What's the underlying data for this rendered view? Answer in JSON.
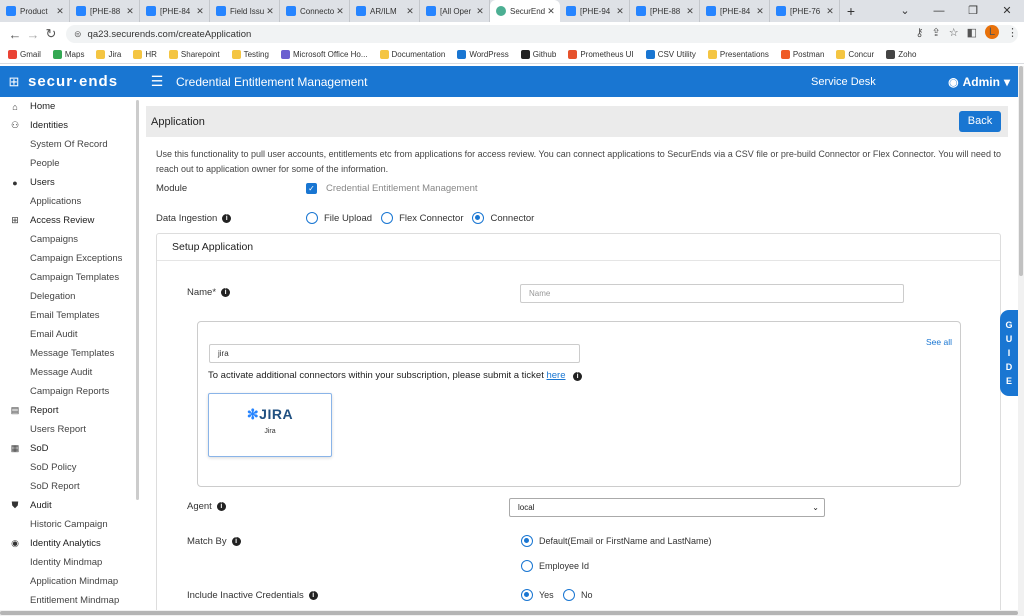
{
  "browser": {
    "tabs": [
      {
        "title": "Product",
        "icon": "puzzle-icon",
        "active": false
      },
      {
        "title": "[PHE-88",
        "icon": "jira-icon",
        "active": false
      },
      {
        "title": "[PHE-84",
        "icon": "jira-icon",
        "active": false
      },
      {
        "title": "Field Issu",
        "icon": "jira-icon",
        "active": false
      },
      {
        "title": "Connecto",
        "icon": "jira-icon",
        "active": false
      },
      {
        "title": "AR/ILM",
        "icon": "jira-icon",
        "active": false
      },
      {
        "title": "[All Oper",
        "icon": "jira-icon",
        "active": false
      },
      {
        "title": "SecurEnd",
        "icon": "globe-icon",
        "active": true
      },
      {
        "title": "[PHE-94",
        "icon": "jira-icon",
        "active": false
      },
      {
        "title": "[PHE-88",
        "icon": "jira-icon",
        "active": false
      },
      {
        "title": "[PHE-84",
        "icon": "jira-icon",
        "active": false
      },
      {
        "title": "[PHE-76",
        "icon": "jira-icon",
        "active": false
      }
    ],
    "new_tab": "+",
    "url": "qa23.securends.com/createApplication",
    "profile_initial": "L",
    "bookmarks": [
      {
        "label": "Gmail",
        "color": "#ea4335"
      },
      {
        "label": "Maps",
        "color": "#34a853"
      },
      {
        "label": "Jira",
        "color": "#f4c542"
      },
      {
        "label": "HR",
        "color": "#f4c542"
      },
      {
        "label": "Sharepoint",
        "color": "#f4c542"
      },
      {
        "label": "Testing",
        "color": "#f4c542"
      },
      {
        "label": "Microsoft Office Ho...",
        "color": "#6b5fd0"
      },
      {
        "label": "Documentation",
        "color": "#f4c542"
      },
      {
        "label": "WordPress",
        "color": "#1976d2"
      },
      {
        "label": "Github",
        "color": "#222222"
      },
      {
        "label": "Prometheus UI",
        "color": "#e6522c"
      },
      {
        "label": "CSV Utility",
        "color": "#1976d2"
      },
      {
        "label": "Presentations",
        "color": "#f4c542"
      },
      {
        "label": "Postman",
        "color": "#ef5b25"
      },
      {
        "label": "Concur",
        "color": "#f4c542"
      },
      {
        "label": "Zoho",
        "color": "#444444"
      }
    ]
  },
  "header": {
    "brand": "secur·ends",
    "title": "Credential Entitlement Management",
    "service_desk": "Service Desk",
    "admin": "Admin"
  },
  "sidebar": {
    "items": [
      {
        "label": "Home",
        "section": true,
        "icon": "home-icon"
      },
      {
        "label": "Identities",
        "section": true,
        "icon": "people-icon"
      },
      {
        "label": "System Of Record",
        "section": false
      },
      {
        "label": "People",
        "section": false
      },
      {
        "label": "Users",
        "section": true,
        "icon": "user-icon"
      },
      {
        "label": "Applications",
        "section": false
      },
      {
        "label": "Access Review",
        "section": true,
        "icon": "grid-icon"
      },
      {
        "label": "Campaigns",
        "section": false
      },
      {
        "label": "Campaign Exceptions",
        "section": false
      },
      {
        "label": "Campaign Templates",
        "section": false
      },
      {
        "label": "Delegation",
        "section": false
      },
      {
        "label": "Email Templates",
        "section": false
      },
      {
        "label": "Email Audit",
        "section": false
      },
      {
        "label": "Message Templates",
        "section": false
      },
      {
        "label": "Message Audit",
        "section": false
      },
      {
        "label": "Campaign Reports",
        "section": false
      },
      {
        "label": "Report",
        "section": true,
        "icon": "report-icon"
      },
      {
        "label": "Users Report",
        "section": false
      },
      {
        "label": "SoD",
        "section": true,
        "icon": "table-icon"
      },
      {
        "label": "SoD Policy",
        "section": false
      },
      {
        "label": "SoD Report",
        "section": false
      },
      {
        "label": "Audit",
        "section": true,
        "icon": "shield-icon"
      },
      {
        "label": "Historic Campaign",
        "section": false
      },
      {
        "label": "Identity Analytics",
        "section": true,
        "icon": "circle-icon"
      },
      {
        "label": "Identity Mindmap",
        "section": false
      },
      {
        "label": "Application Mindmap",
        "section": false
      },
      {
        "label": "Entitlement Mindmap",
        "section": false
      }
    ]
  },
  "page": {
    "title": "Application",
    "back_label": "Back",
    "description": "Use this functionality to pull user accounts, entitlements etc from applications for access review. You can connect applications to SecurEnds via a CSV file or pre-build Connector or Flex Connector. You will need to reach out to application owner for some of the information.",
    "module_label": "Module",
    "module_value": "Credential Entitlement Management",
    "module_checked": true,
    "ingestion_label": "Data Ingestion",
    "ingestion_options": [
      "File Upload",
      "Flex Connector",
      "Connector"
    ],
    "ingestion_selected": "Connector"
  },
  "setup": {
    "title": "Setup Application",
    "name_label": "Name*",
    "name_placeholder": "Name",
    "connector_search_value": "jira",
    "see_all": "See all",
    "activate_text": "To activate additional connectors within your subscription, please submit a ticket",
    "activate_link": "here",
    "connector_card": {
      "logo": "JIRA",
      "label": "Jira"
    },
    "agent_label": "Agent",
    "agent_value": "local",
    "match_by_label": "Match By",
    "match_by_options": [
      "Default(Email or FirstName and LastName)",
      "Employee Id"
    ],
    "match_by_selected": "Default(Email or FirstName and LastName)",
    "inactive_label": "Include Inactive Credentials",
    "inactive_options": [
      "Yes",
      "No"
    ],
    "inactive_selected": "Yes"
  },
  "guide": {
    "label": "GUIDE"
  },
  "colors": {
    "primary": "#1976d2",
    "titlebar": "#ebebeb"
  }
}
